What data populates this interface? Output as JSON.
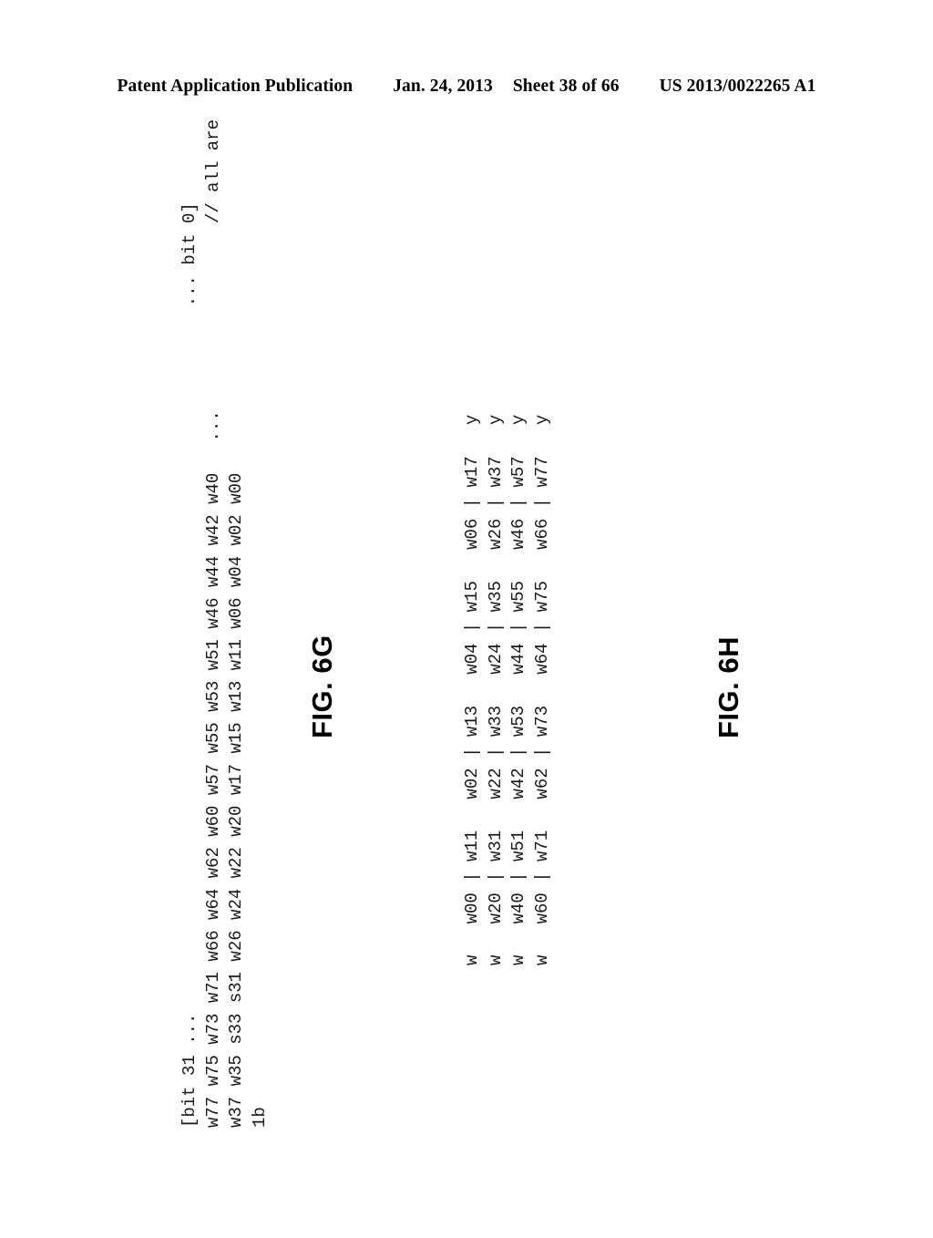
{
  "header": {
    "publication_label": "Patent Application Publication",
    "date": "Jan. 24, 2013",
    "sheet": "Sheet 38 of 66",
    "publication_number": "US 2013/0022265 A1"
  },
  "figures": [
    {
      "id": "fig-6g",
      "caption": "FIG. 6G",
      "listing_lines": [
        "                                                                     // all are",
        "",
        "                                                         ...",
        "w40 w42 w02 w00",
        "w44 w04",
        "w46 w06",
        "w51 w11",
        "w53 w13",
        "w55 w15",
        "w57 w17",
        "w60 w20",
        "w62 w22",
        "w64 w24",
        "w66 w26",
        "w71 w31",
        "w73 s33",
        "w75 w35",
        "w77 w37",
        "[bit 31 ...",
        "... bit 0]",
        "1b"
      ],
      "listing_text_rows": [
        {
          "label": "comment",
          "text": "// all are"
        },
        {
          "label": "ellipsis",
          "text": "..."
        },
        {
          "label": "row-bit31",
          "text": "[bit 31 ..."
        },
        {
          "label": "row-bit0",
          "text": "... bit 0]"
        },
        {
          "label": "row-1b",
          "text": "1b"
        },
        {
          "label": "row-w77",
          "text": "w77 w75 w73 w71 w66 w64 w62 w60 w57 w55 w53 w51 w46 w44 w42 w40"
        },
        {
          "label": "row-w37",
          "text": "w37 w35 s33 s31 w26 w24 w22 w20 w17 w15 w13 w11 w06 w04 w02 w00"
        }
      ],
      "rendered_rows": [
        "[bit 31 ...                                                                    ... bit 0]",
        "w77 w75 w73 w71 w66 w64 w62 w60 w57 w55 w53 w51 w46 w44 w42 w40   ...                  // all are",
        "w37 w35 s33 s31 w26 w24 w22 w20 w17 w15 w13 w11 w06 w04 w02 w00",
        "1b"
      ]
    },
    {
      "id": "fig-6h",
      "caption": "FIG. 6H",
      "rendered_rows": [
        "w   w00 | w11   w02 | w13   w04 | w15   w06 | w17   y",
        "w   w20 | w31   w22 | w33   w24 | w35   w26 | w37   y",
        "w   w40 | w51   w42 | w53   w44 | w55   w46 | w57   y",
        "w   w60 | w71   w62 | w73   w64 | w75   w66 | w77   y"
      ],
      "matrix": [
        {
          "prefix": "w",
          "cells": [
            "w00",
            "|",
            "w11",
            "w02",
            "|",
            "w13",
            "w04",
            "|",
            "w15",
            "w06",
            "|",
            "w17"
          ],
          "suffix": "y"
        },
        {
          "prefix": "w",
          "cells": [
            "w20",
            "|",
            "w31",
            "w22",
            "|",
            "w33",
            "w24",
            "|",
            "w35",
            "w26",
            "|",
            "w37"
          ],
          "suffix": "y"
        },
        {
          "prefix": "w",
          "cells": [
            "w40",
            "|",
            "w51",
            "w42",
            "|",
            "w53",
            "w44",
            "|",
            "w55",
            "w46",
            "|",
            "w57"
          ],
          "suffix": "y"
        },
        {
          "prefix": "w",
          "cells": [
            "w60",
            "|",
            "w71",
            "w62",
            "|",
            "w73",
            "w64",
            "|",
            "w75",
            "w66",
            "|",
            "w77"
          ],
          "suffix": "y"
        }
      ]
    }
  ]
}
